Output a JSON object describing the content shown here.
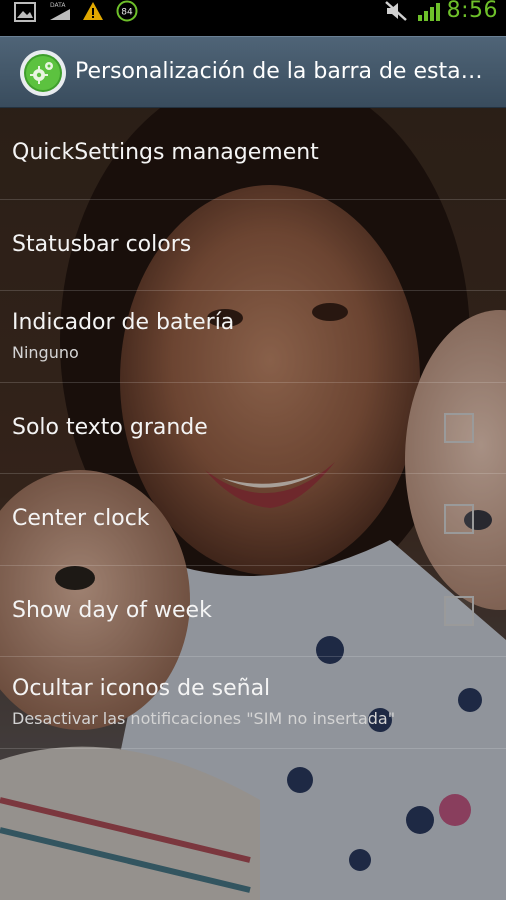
{
  "status_bar": {
    "time": "8:56",
    "battery_level": "84",
    "icons": [
      "image-icon",
      "data-icon",
      "warning-icon",
      "battery-icon",
      "mute-icon",
      "signal-icon"
    ],
    "clock_color": "#6ec02a"
  },
  "action_bar": {
    "title": "Personalización de la barra de esta…",
    "app_icon": "gear-icon"
  },
  "preferences": [
    {
      "title": "QuickSettings management",
      "summary": null,
      "type": "screen"
    },
    {
      "title": "Statusbar colors",
      "summary": null,
      "type": "screen"
    },
    {
      "title": "Indicador de batería",
      "summary": "Ninguno",
      "type": "list"
    },
    {
      "title": "Solo texto grande",
      "summary": null,
      "type": "checkbox",
      "checked": false
    },
    {
      "title": "Center clock",
      "summary": null,
      "type": "checkbox",
      "checked": false
    },
    {
      "title": "Show day of week",
      "summary": null,
      "type": "checkbox",
      "checked": false
    },
    {
      "title": "Ocultar iconos de señal",
      "summary": "Desactivar las notificaciones \"SIM no insertada\"",
      "type": "screen"
    }
  ],
  "colors": {
    "actionbar_top": "#4f6477",
    "actionbar_bottom": "#394c5d",
    "accent_green": "#6ec02a"
  }
}
